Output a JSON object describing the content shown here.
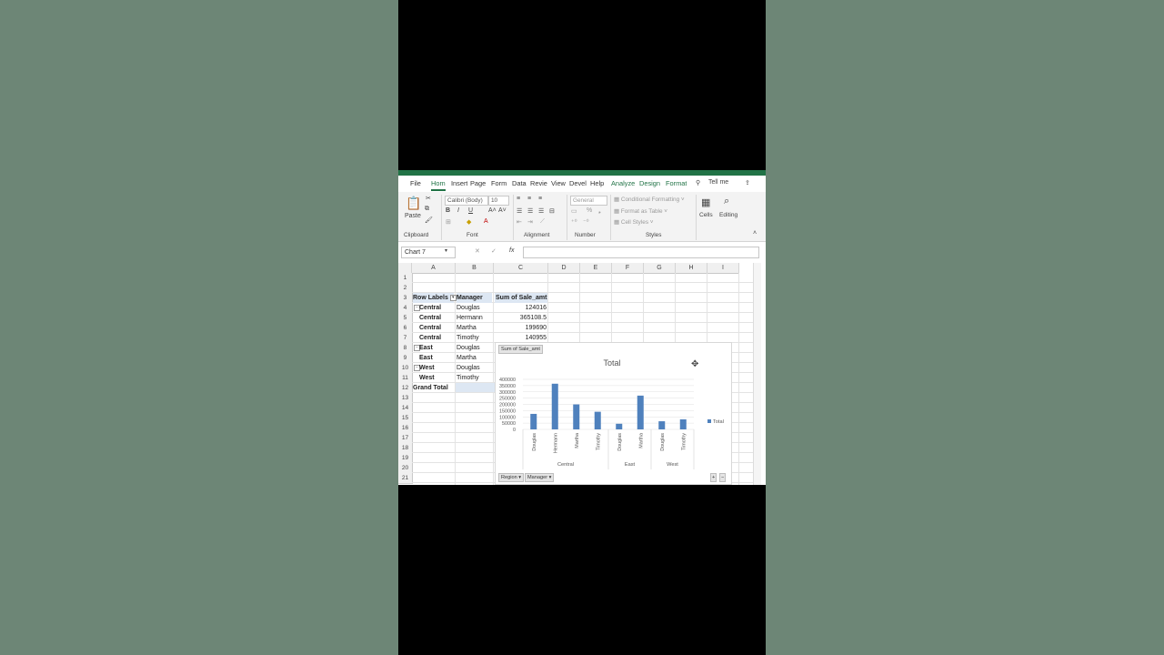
{
  "ribbon": {
    "tabs": [
      {
        "label": "File",
        "selected": false,
        "contextual": false
      },
      {
        "label": "Hom",
        "selected": true,
        "contextual": false
      },
      {
        "label": "Insert",
        "selected": false,
        "contextual": false
      },
      {
        "label": "Page",
        "selected": false,
        "contextual": false
      },
      {
        "label": "Form",
        "selected": false,
        "contextual": false
      },
      {
        "label": "Data",
        "selected": false,
        "contextual": false
      },
      {
        "label": "Revie",
        "selected": false,
        "contextual": false
      },
      {
        "label": "View",
        "selected": false,
        "contextual": false
      },
      {
        "label": "Devel",
        "selected": false,
        "contextual": false
      },
      {
        "label": "Help",
        "selected": false,
        "contextual": false
      },
      {
        "label": "Analyze",
        "selected": false,
        "contextual": true
      },
      {
        "label": "Design",
        "selected": false,
        "contextual": true
      },
      {
        "label": "Format",
        "selected": false,
        "contextual": true
      }
    ],
    "tell_me": "Tell me",
    "paste_label": "Paste",
    "font_name": "Calibri (Body)",
    "font_size": "10",
    "number_format": "General",
    "conditional_formatting": "Conditional Formatting",
    "format_as_table": "Format as Table",
    "cell_styles": "Cell Styles",
    "cells_label": "Cells",
    "editing_label": "Editing",
    "groups": {
      "clipboard": "Clipboard",
      "font": "Font",
      "alignment": "Alignment",
      "number": "Number",
      "styles": "Styles"
    }
  },
  "formula_bar": {
    "name_box": "Chart 7",
    "fx": "fx",
    "formula": ""
  },
  "columns": [
    "A",
    "B",
    "C",
    "D",
    "E",
    "F",
    "G",
    "H",
    "I"
  ],
  "rows": [
    "1",
    "2",
    "3",
    "4",
    "5",
    "6",
    "7",
    "8",
    "9",
    "10",
    "11",
    "12",
    "13",
    "14",
    "15",
    "16",
    "17",
    "18",
    "19",
    "20",
    "21"
  ],
  "pivot": {
    "headers": {
      "row_labels": "Row Labels",
      "manager": "Manager",
      "sum": "Sum of Sale_amt"
    },
    "rows": [
      {
        "region": "Central",
        "manager": "Douglas",
        "value": "124016",
        "collapse": true
      },
      {
        "region": "Central",
        "manager": "Hermann",
        "value": "365108.5",
        "collapse": false
      },
      {
        "region": "Central",
        "manager": "Martha",
        "value": "199690",
        "collapse": false
      },
      {
        "region": "Central",
        "manager": "Timothy",
        "value": "140955",
        "collapse": false
      },
      {
        "region": "East",
        "manager": "Douglas",
        "value": "",
        "collapse": true
      },
      {
        "region": "East",
        "manager": "Martha",
        "value": "",
        "collapse": false
      },
      {
        "region": "West",
        "manager": "Douglas",
        "value": "",
        "collapse": true
      },
      {
        "region": "West",
        "manager": "Timothy",
        "value": "",
        "collapse": false
      }
    ],
    "grand_total": "Grand Total"
  },
  "colors": {
    "excel_green": "#217346",
    "bar": "#4f81bd",
    "header_fill": "#dde7f3"
  },
  "chart_data": {
    "type": "bar",
    "title": "Total",
    "value_field_button": "Sum of Sale_amt",
    "categories": [
      "Douglas",
      "Hermann",
      "Martha",
      "Timothy",
      "Douglas",
      "Martha",
      "Douglas",
      "Timothy"
    ],
    "groups": [
      {
        "label": "Central",
        "count": 4
      },
      {
        "label": "East",
        "count": 2
      },
      {
        "label": "West",
        "count": 2
      }
    ],
    "series": [
      {
        "name": "Total",
        "values": [
          124016,
          365108.5,
          199690,
          140955,
          45000,
          270000,
          65000,
          80000
        ]
      }
    ],
    "ylim": [
      0,
      400000
    ],
    "yticks": [
      0,
      50000,
      100000,
      150000,
      200000,
      250000,
      300000,
      350000,
      400000
    ],
    "grid": true,
    "legend": "right",
    "axis_field_buttons": [
      "Region",
      "Manager"
    ]
  }
}
